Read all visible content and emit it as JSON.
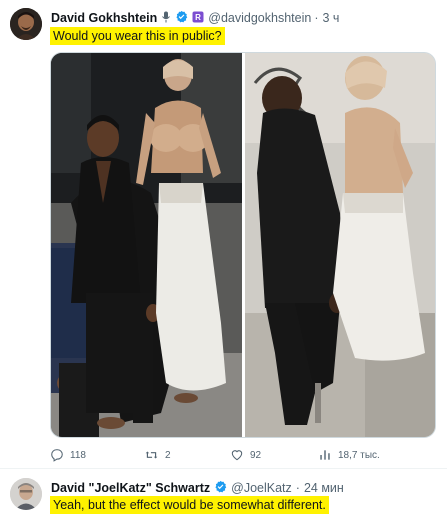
{
  "tweet": {
    "author_name": "David Gokhshtein",
    "author_handle": "@davidgokhshtein",
    "separator": "·",
    "time": "3 ч",
    "text": "Would you wear this in public?",
    "stats": {
      "replies": "118",
      "retweets": "2",
      "likes": "92",
      "views": "18,7 тыс."
    }
  },
  "reply": {
    "author_name": "David \"JoelKatz\" Schwartz",
    "author_handle": "@JoelKatz",
    "separator": "·",
    "time": "24 мин",
    "text": "Yeah, but the effect would be somewhat different."
  },
  "colors": {
    "highlight": "#fff200",
    "verified": "#1d9bf0",
    "muted_text": "#536471",
    "border": "#cfd9de"
  },
  "icons": [
    "microphone-icon",
    "verified-badge-icon",
    "affiliate-badge-icon",
    "reply-icon",
    "retweet-icon",
    "like-icon",
    "views-icon"
  ]
}
